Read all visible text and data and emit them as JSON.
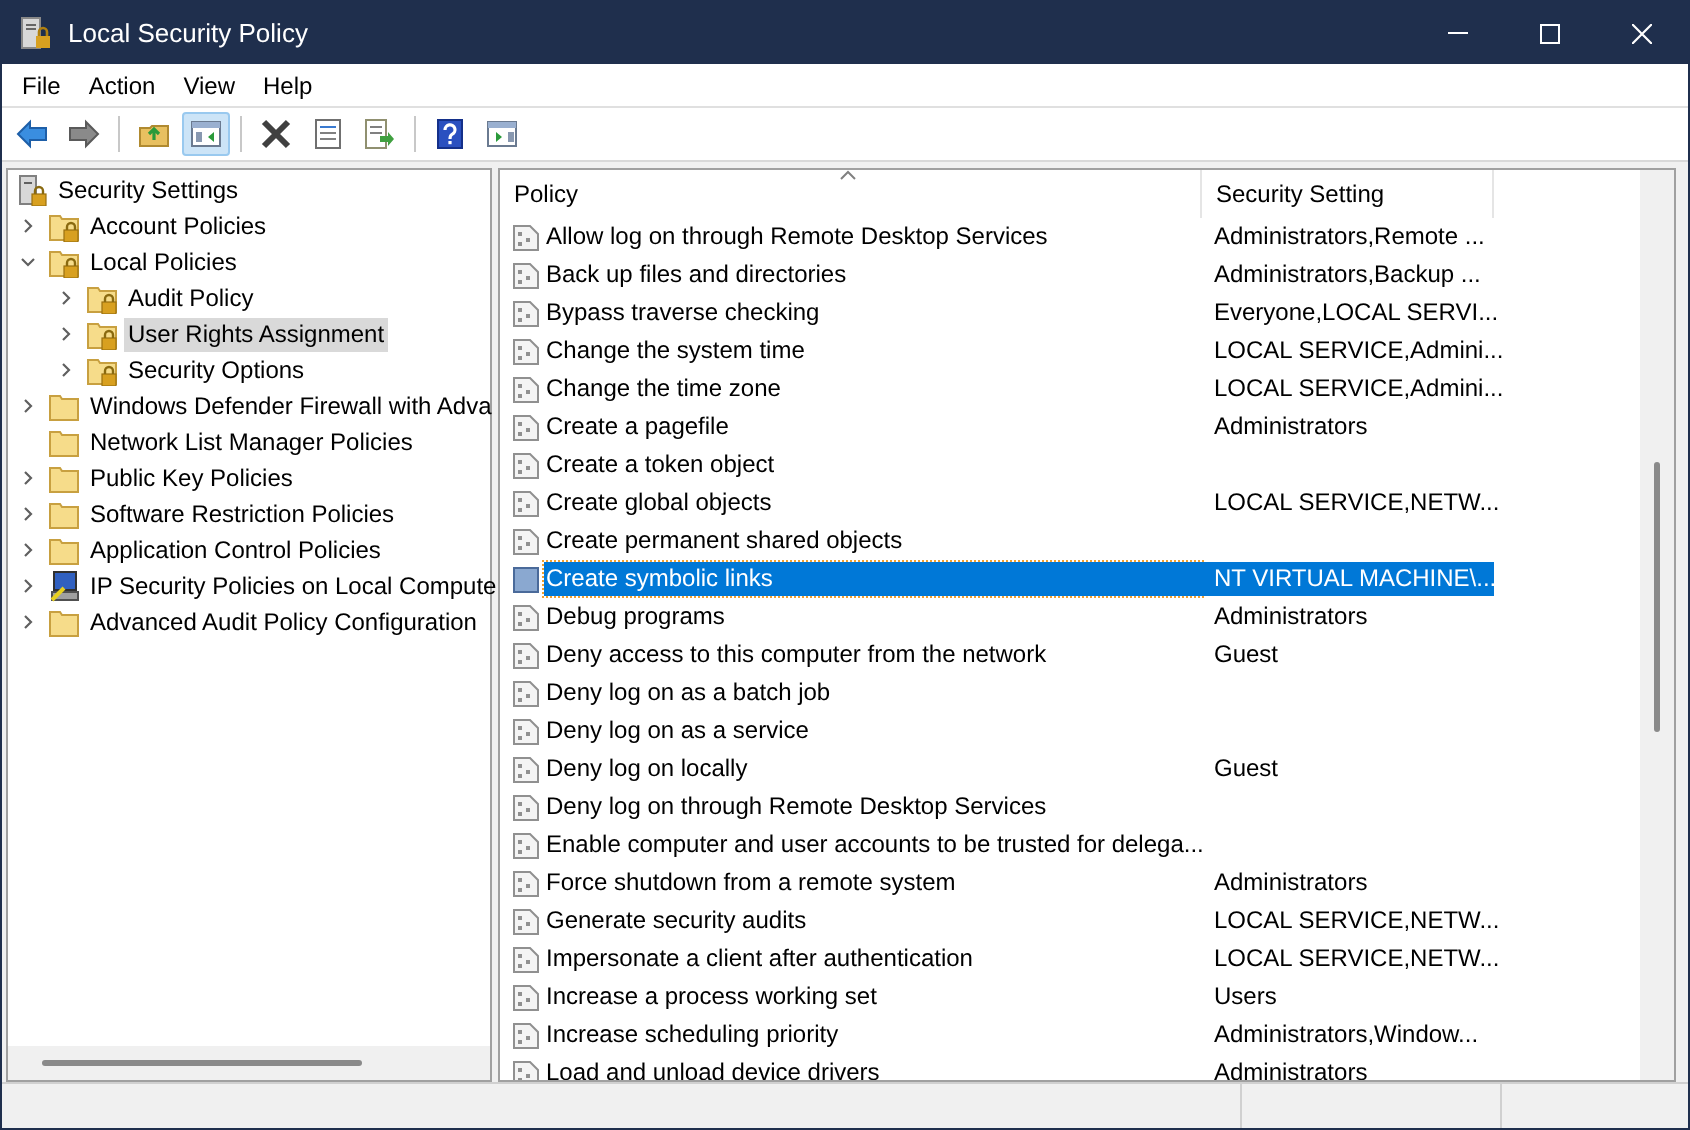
{
  "window": {
    "title": "Local Security Policy"
  },
  "menu": [
    "File",
    "Action",
    "View",
    "Help"
  ],
  "toolbar": [
    {
      "kind": "back",
      "pressed": false
    },
    {
      "kind": "forward",
      "pressed": false
    },
    {
      "kind": "up",
      "pressed": false
    },
    {
      "kind": "tree",
      "pressed": true
    },
    {
      "kind": "delete",
      "pressed": false
    },
    {
      "kind": "properties",
      "pressed": false
    },
    {
      "kind": "export",
      "pressed": false
    },
    {
      "kind": "help",
      "pressed": false
    },
    {
      "kind": "actionpane",
      "pressed": false
    }
  ],
  "tree": [
    {
      "label": "Security Settings",
      "kind": "root",
      "selected": false,
      "children": [
        {
          "label": "Account Policies",
          "kind": "locked-folder",
          "expandable": true,
          "expanded": false,
          "selected": false
        },
        {
          "label": "Local Policies",
          "kind": "locked-folder",
          "expandable": true,
          "expanded": true,
          "selected": false,
          "children": [
            {
              "label": "Audit Policy",
              "kind": "locked-folder",
              "expandable": true,
              "expanded": false,
              "selected": false
            },
            {
              "label": "User Rights Assignment",
              "kind": "locked-folder",
              "expandable": true,
              "expanded": false,
              "selected": true
            },
            {
              "label": "Security Options",
              "kind": "locked-folder",
              "expandable": true,
              "expanded": false,
              "selected": false
            }
          ]
        },
        {
          "label": "Windows Defender Firewall with Adva",
          "kind": "folder",
          "expandable": true,
          "expanded": false,
          "selected": false
        },
        {
          "label": "Network List Manager Policies",
          "kind": "folder",
          "expandable": false,
          "expanded": false,
          "selected": false
        },
        {
          "label": "Public Key Policies",
          "kind": "folder",
          "expandable": true,
          "expanded": false,
          "selected": false
        },
        {
          "label": "Software Restriction Policies",
          "kind": "folder",
          "expandable": true,
          "expanded": false,
          "selected": false
        },
        {
          "label": "Application Control Policies",
          "kind": "folder",
          "expandable": true,
          "expanded": false,
          "selected": false
        },
        {
          "label": "IP Security Policies on Local Compute",
          "kind": "computer",
          "expandable": true,
          "expanded": false,
          "selected": false
        },
        {
          "label": "Advanced Audit Policy Configuration",
          "kind": "folder",
          "expandable": true,
          "expanded": false,
          "selected": false
        }
      ]
    }
  ],
  "table": {
    "columns": [
      "Policy",
      "Security Setting"
    ],
    "rows": [
      {
        "policy": "Allow log on through Remote Desktop Services",
        "setting": "Administrators,Remote ...",
        "selected": false
      },
      {
        "policy": "Back up files and directories",
        "setting": "Administrators,Backup ...",
        "selected": false
      },
      {
        "policy": "Bypass traverse checking",
        "setting": "Everyone,LOCAL SERVI...",
        "selected": false
      },
      {
        "policy": "Change the system time",
        "setting": "LOCAL SERVICE,Admini...",
        "selected": false
      },
      {
        "policy": "Change the time zone",
        "setting": "LOCAL SERVICE,Admini...",
        "selected": false
      },
      {
        "policy": "Create a pagefile",
        "setting": "Administrators",
        "selected": false
      },
      {
        "policy": "Create a token object",
        "selected": false
      },
      {
        "policy": "Create global objects",
        "setting": "LOCAL SERVICE,NETW...",
        "selected": false
      },
      {
        "policy": "Create permanent shared objects",
        "selected": false
      },
      {
        "policy": "Create symbolic links",
        "setting": "NT VIRTUAL MACHINE\\...",
        "selected": true
      },
      {
        "policy": "Debug programs",
        "setting": "Administrators",
        "selected": false
      },
      {
        "policy": "Deny access to this computer from the network",
        "setting": "Guest",
        "selected": false
      },
      {
        "policy": "Deny log on as a batch job",
        "selected": false
      },
      {
        "policy": "Deny log on as a service",
        "selected": false
      },
      {
        "policy": "Deny log on locally",
        "setting": "Guest",
        "selected": false
      },
      {
        "policy": "Deny log on through Remote Desktop Services",
        "selected": false
      },
      {
        "policy": "Enable computer and user accounts to be trusted for delega...",
        "selected": false
      },
      {
        "policy": "Force shutdown from a remote system",
        "setting": "Administrators",
        "selected": false
      },
      {
        "policy": "Generate security audits",
        "setting": "LOCAL SERVICE,NETW...",
        "selected": false
      },
      {
        "policy": "Impersonate a client after authentication",
        "setting": "LOCAL SERVICE,NETW...",
        "selected": false
      },
      {
        "policy": "Increase a process working set",
        "setting": "Users",
        "selected": false
      },
      {
        "policy": "Increase scheduling priority",
        "setting": "Administrators,Window...",
        "selected": false
      },
      {
        "policy": "Load and unload device drivers",
        "setting": "Administrators",
        "selected": false
      }
    ]
  }
}
